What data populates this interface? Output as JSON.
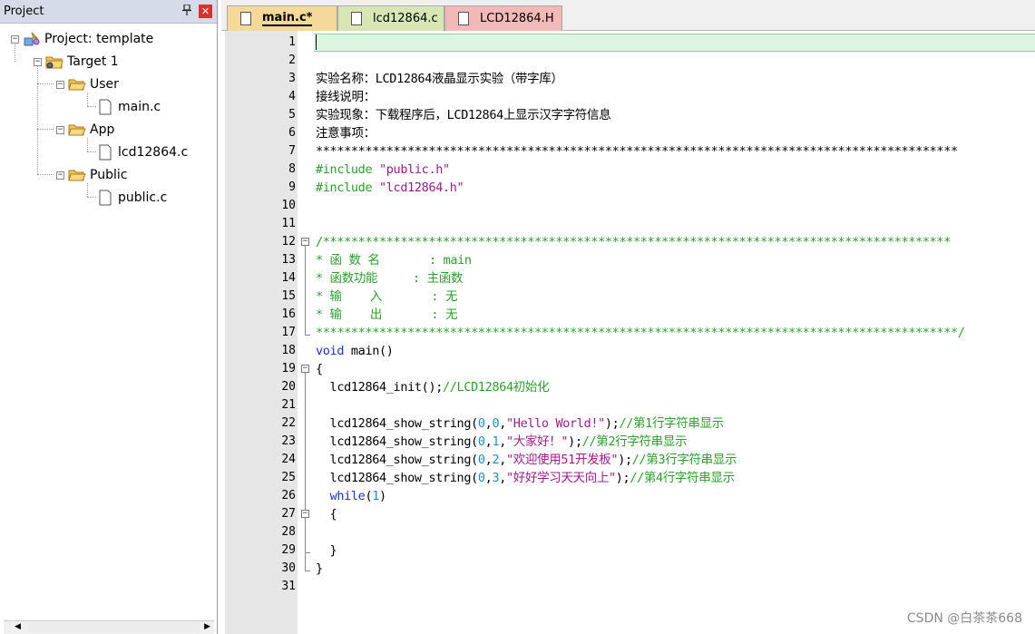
{
  "project_panel": {
    "title": "Project",
    "pin_icon": "pin-icon",
    "close_icon": "close-icon",
    "tree": {
      "root": "Project: template",
      "target": "Target 1",
      "groups": [
        {
          "name": "User",
          "files": [
            "main.c"
          ]
        },
        {
          "name": "App",
          "files": [
            "lcd12864.c"
          ]
        },
        {
          "name": "Public",
          "files": [
            "public.c"
          ]
        }
      ]
    }
  },
  "tabs": [
    {
      "label": "main.c*",
      "active": true,
      "color": "#f5d99a"
    },
    {
      "label": "lcd12864.c",
      "active": false,
      "color": "#d8e6b6"
    },
    {
      "label": "LCD12864.H",
      "active": false,
      "color": "#f3b8b8"
    }
  ],
  "colors": {
    "comment": "#2c9f2c",
    "string": "#9b1c8c",
    "keyword": "#1c2fd6",
    "number": "#1f8fc2",
    "current_line": "#dcf4e0"
  },
  "code_lines": [
    {
      "n": "1",
      "segments": []
    },
    {
      "n": "2",
      "segments": []
    },
    {
      "n": "3",
      "segments": [
        {
          "t": "实验名称：LCD12864液晶显示实验（带字库）",
          "c": "default"
        }
      ]
    },
    {
      "n": "4",
      "segments": [
        {
          "t": "接线说明：",
          "c": "default"
        }
      ]
    },
    {
      "n": "5",
      "segments": [
        {
          "t": "实验现象：下载程序后，LCD12864上显示汉字字符信息",
          "c": "default"
        }
      ]
    },
    {
      "n": "6",
      "segments": [
        {
          "t": "注意事项：",
          "c": "default"
        }
      ]
    },
    {
      "n": "7",
      "segments": [
        {
          "t": "*******************************************************************************************",
          "c": "default"
        }
      ]
    },
    {
      "n": "8",
      "segments": [
        {
          "t": "#include ",
          "c": "comment"
        },
        {
          "t": "\"public.h\"",
          "c": "string"
        }
      ]
    },
    {
      "n": "9",
      "segments": [
        {
          "t": "#include ",
          "c": "comment"
        },
        {
          "t": "\"lcd12864.h\"",
          "c": "string"
        }
      ]
    },
    {
      "n": "10",
      "segments": []
    },
    {
      "n": "11",
      "segments": []
    },
    {
      "n": "12",
      "segments": [
        {
          "t": "/*****************************************************************************************",
          "c": "comment"
        }
      ]
    },
    {
      "n": "13",
      "segments": [
        {
          "t": "* 函 数 名       : main",
          "c": "comment"
        }
      ]
    },
    {
      "n": "14",
      "segments": [
        {
          "t": "* 函数功能     : 主函数",
          "c": "comment"
        }
      ]
    },
    {
      "n": "15",
      "segments": [
        {
          "t": "* 输    入       : 无",
          "c": "comment"
        }
      ]
    },
    {
      "n": "16",
      "segments": [
        {
          "t": "* 输    出       : 无",
          "c": "comment"
        }
      ]
    },
    {
      "n": "17",
      "segments": [
        {
          "t": "*******************************************************************************************/",
          "c": "comment"
        }
      ]
    },
    {
      "n": "18",
      "segments": [
        {
          "t": "void",
          "c": "keyword"
        },
        {
          "t": " main()",
          "c": "default"
        }
      ]
    },
    {
      "n": "19",
      "segments": [
        {
          "t": "{",
          "c": "default"
        }
      ]
    },
    {
      "n": "20",
      "segments": [
        {
          "t": "  lcd12864_init();",
          "c": "default"
        },
        {
          "t": "//LCD12864初始化",
          "c": "comment"
        }
      ]
    },
    {
      "n": "21",
      "segments": []
    },
    {
      "n": "22",
      "segments": [
        {
          "t": "  lcd12864_show_string(",
          "c": "default"
        },
        {
          "t": "0",
          "c": "number"
        },
        {
          "t": ",",
          "c": "default"
        },
        {
          "t": "0",
          "c": "number"
        },
        {
          "t": ",",
          "c": "default"
        },
        {
          "t": "\"Hello World!\"",
          "c": "string"
        },
        {
          "t": ");",
          "c": "default"
        },
        {
          "t": "//第1行字符串显示",
          "c": "comment"
        }
      ]
    },
    {
      "n": "23",
      "segments": [
        {
          "t": "  lcd12864_show_string(",
          "c": "default"
        },
        {
          "t": "0",
          "c": "number"
        },
        {
          "t": ",",
          "c": "default"
        },
        {
          "t": "1",
          "c": "number"
        },
        {
          "t": ",",
          "c": "default"
        },
        {
          "t": "\"大家好！\"",
          "c": "string"
        },
        {
          "t": ");",
          "c": "default"
        },
        {
          "t": "//第2行字符串显示",
          "c": "comment"
        }
      ]
    },
    {
      "n": "24",
      "segments": [
        {
          "t": "  lcd12864_show_string(",
          "c": "default"
        },
        {
          "t": "0",
          "c": "number"
        },
        {
          "t": ",",
          "c": "default"
        },
        {
          "t": "2",
          "c": "number"
        },
        {
          "t": ",",
          "c": "default"
        },
        {
          "t": "\"欢迎使用51开发板\"",
          "c": "string"
        },
        {
          "t": ");",
          "c": "default"
        },
        {
          "t": "//第3行字符串显示",
          "c": "comment"
        }
      ]
    },
    {
      "n": "25",
      "segments": [
        {
          "t": "  lcd12864_show_string(",
          "c": "default"
        },
        {
          "t": "0",
          "c": "number"
        },
        {
          "t": ",",
          "c": "default"
        },
        {
          "t": "3",
          "c": "number"
        },
        {
          "t": ",",
          "c": "default"
        },
        {
          "t": "\"好好学习天天向上\"",
          "c": "string"
        },
        {
          "t": ");",
          "c": "default"
        },
        {
          "t": "//第4行字符串显示",
          "c": "comment"
        }
      ]
    },
    {
      "n": "26",
      "segments": [
        {
          "t": "  ",
          "c": "default"
        },
        {
          "t": "while",
          "c": "keyword"
        },
        {
          "t": "(",
          "c": "default"
        },
        {
          "t": "1",
          "c": "number"
        },
        {
          "t": ")",
          "c": "default"
        }
      ]
    },
    {
      "n": "27",
      "segments": [
        {
          "t": "  {",
          "c": "default"
        }
      ]
    },
    {
      "n": "28",
      "segments": []
    },
    {
      "n": "29",
      "segments": [
        {
          "t": "  }",
          "c": "default"
        }
      ]
    },
    {
      "n": "30",
      "segments": [
        {
          "t": "}",
          "c": "default"
        }
      ]
    },
    {
      "n": "31",
      "segments": []
    }
  ],
  "watermark": "CSDN @白茶茶668"
}
